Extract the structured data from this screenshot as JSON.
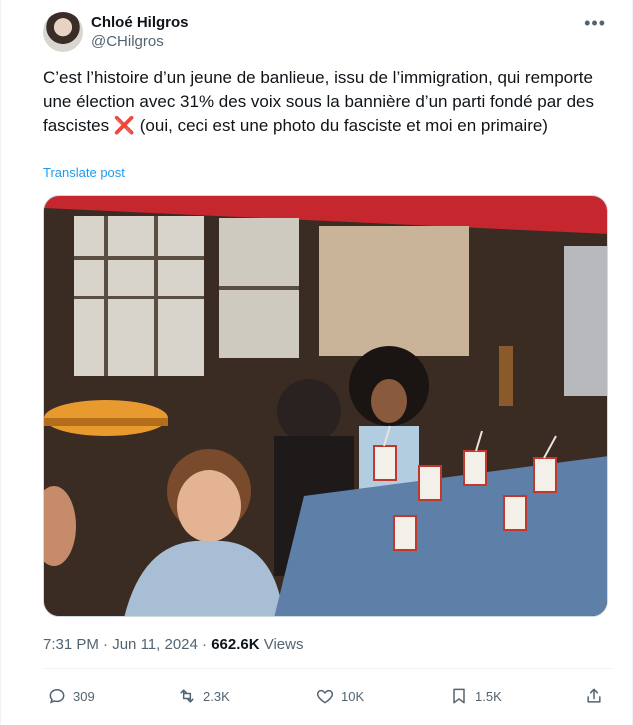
{
  "author": {
    "display_name": "Chloé Hilgros",
    "handle": "@CHilgros"
  },
  "post": {
    "text_before": "C’est l’histoire d’un jeune de banlieue, issu de l’immigration, qui remporte une élection avec 31% des voix sous la bannière d’un parti fondé par des fascistes",
    "emoji": "❌",
    "text_after": " (oui, ceci est une photo du fasciste et moi en primaire)",
    "translate_label": "Translate post"
  },
  "meta": {
    "time": "7:31 PM",
    "separator": " · ",
    "date": "Jun 11, 2024",
    "views_count": "662.6K",
    "views_label": " Views"
  },
  "actions": {
    "replies": "309",
    "reposts": "2.3K",
    "likes": "10K",
    "bookmarks": "1.5K"
  },
  "colors": {
    "accent": "#1d9bf0",
    "secondary_text": "#536471",
    "primary_text": "#0f1419"
  },
  "icons": [
    "more-icon",
    "reply-icon",
    "repost-icon",
    "like-icon",
    "bookmark-icon",
    "share-icon"
  ]
}
